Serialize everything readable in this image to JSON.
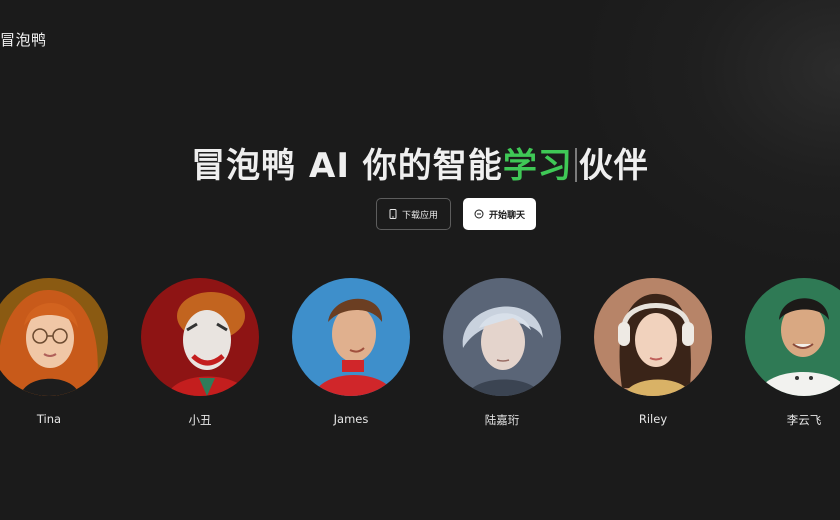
{
  "header": {
    "logo_text": "冒泡鸭"
  },
  "hero": {
    "title_part1": "冒泡鸭 AI 你的智能",
    "title_accent": "学习",
    "title_part2": "伙伴",
    "accent_color": "#3fc856"
  },
  "actions": {
    "download_label": "下载应用",
    "download_icon": "phone-icon",
    "chat_label": "开始聊天",
    "chat_icon": "chat-bubble-icon"
  },
  "characters": [
    {
      "name": "Tina",
      "bg": "#8a5a12"
    },
    {
      "name": "小丑",
      "bg": "#8e1414"
    },
    {
      "name": "James",
      "bg": "#3e8fcb"
    },
    {
      "name": "陆嘉珩",
      "bg": "#5a6577"
    },
    {
      "name": "Riley",
      "bg": "#b78468"
    },
    {
      "name": "李云飞",
      "bg": "#2f7a55"
    }
  ]
}
